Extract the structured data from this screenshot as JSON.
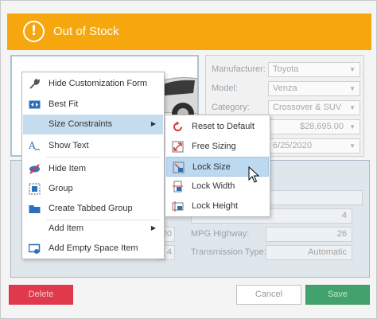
{
  "banner": {
    "title": "Out of Stock",
    "icon": "exclamation-circle-icon",
    "color": "#f5a70d"
  },
  "details": {
    "manufacturer_label": "Manufacturer:",
    "manufacturer_value": "Toyota",
    "model_label": "Model:",
    "model_value": "Venza",
    "category_label": "Category:",
    "category_value": "Crossover & SUV",
    "price_value": "$28,695.00",
    "date_value": "6/25/2020"
  },
  "lower_form": {
    "value_4": "4",
    "value_20": "20",
    "value_4b": "4",
    "mpg_highway_label": "MPG Highway:",
    "mpg_highway_value": "26",
    "transmission_type_label": "Transmission Type:",
    "transmission_type_value": "Automatic"
  },
  "buttons": {
    "delete": "Delete",
    "cancel": "Cancel",
    "save": "Save"
  },
  "context_menu": {
    "items": [
      {
        "label": "Hide Customization Form",
        "icon": "wrench-icon"
      },
      {
        "label": "Best Fit",
        "icon": "best-fit-icon"
      },
      {
        "label": "Size Constraints",
        "icon": "",
        "has_submenu": true,
        "highlighted": true
      },
      {
        "label": "Show Text",
        "icon": "text-icon"
      },
      {
        "label": "Hide Item",
        "icon": "hide-icon"
      },
      {
        "label": "Group",
        "icon": "group-icon"
      },
      {
        "label": "Create Tabbed Group",
        "icon": "folder-icon"
      },
      {
        "label": "Add Item",
        "icon": "",
        "has_submenu": true
      },
      {
        "label": "Add Empty Space Item",
        "icon": "empty-space-icon"
      }
    ]
  },
  "submenu": {
    "items": [
      {
        "label": "Reset to Default",
        "icon": "reset-icon"
      },
      {
        "label": "Free Sizing",
        "icon": "free-sizing-icon"
      },
      {
        "label": "Lock Size",
        "icon": "lock-size-icon",
        "highlighted": true
      },
      {
        "label": "Lock Width",
        "icon": "lock-width-icon"
      },
      {
        "label": "Lock Height",
        "icon": "lock-height-icon"
      }
    ]
  }
}
